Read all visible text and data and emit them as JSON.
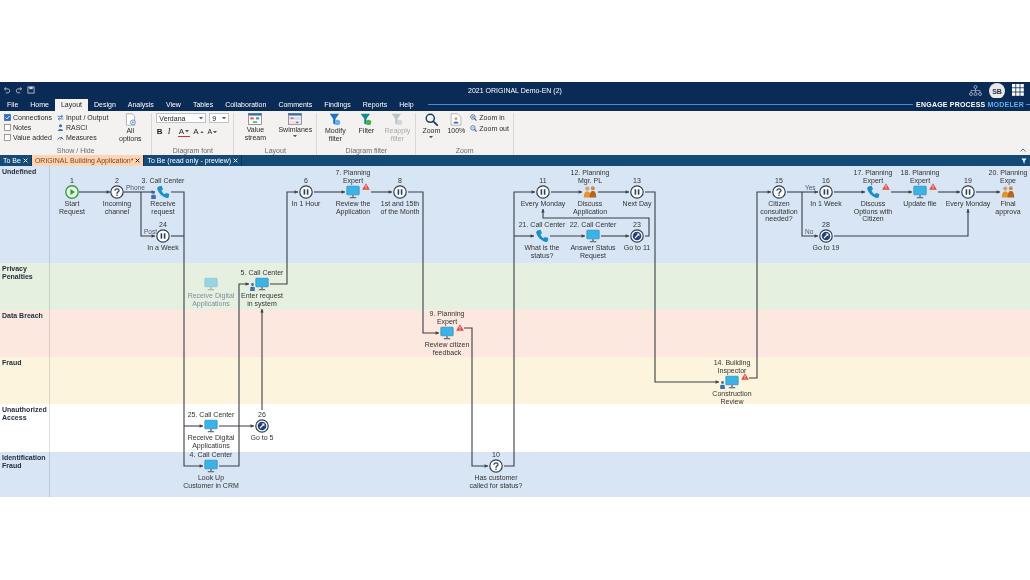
{
  "window": {
    "title": "2021 ORIGINAL Demo-EN (2)",
    "avatar": "SB"
  },
  "menu": [
    {
      "label": "File",
      "selected": false
    },
    {
      "label": "Home",
      "selected": false
    },
    {
      "label": "Layout",
      "selected": true
    },
    {
      "label": "Design",
      "selected": false
    },
    {
      "label": "Analysis",
      "selected": false
    },
    {
      "label": "View",
      "selected": false
    },
    {
      "label": "Tables",
      "selected": false
    },
    {
      "label": "Collaboration",
      "selected": false
    },
    {
      "label": "Comments",
      "selected": false
    },
    {
      "label": "Findings",
      "selected": false
    },
    {
      "label": "Reports",
      "selected": false
    },
    {
      "label": "Help",
      "selected": false
    }
  ],
  "logo": {
    "primary": "ENGAGE PROCESS",
    "secondary": "MODELER"
  },
  "ribbon": {
    "show_hide": {
      "label": "Show / Hide",
      "checkboxes": [
        {
          "label": "Connections",
          "checked": true
        },
        {
          "label": "Notes",
          "checked": false
        },
        {
          "label": "Value added",
          "checked": false
        }
      ],
      "toggles": [
        {
          "label": "Input / Output",
          "kind": "io"
        },
        {
          "label": "RASCI",
          "kind": "rasci"
        },
        {
          "label": "Measures",
          "kind": "measures"
        }
      ],
      "all_options": "All options"
    },
    "font": {
      "label": "Diagram font",
      "family": "Verdana",
      "size": "9",
      "buttons": [
        {
          "text": "B",
          "kind": "bold"
        },
        {
          "text": "I",
          "kind": "italic"
        },
        {
          "text": "A",
          "kind": "color"
        },
        {
          "text": "A",
          "kind": "grow"
        },
        {
          "text": "A",
          "kind": "shrink"
        }
      ]
    },
    "layout": {
      "label": "Layout",
      "buttons": [
        {
          "label": "Value stream",
          "kind": "value_stream",
          "menu": false
        },
        {
          "label": "Swimlanes",
          "kind": "swimlanes",
          "menu": true
        }
      ]
    },
    "filter": {
      "label": "Diagram filter",
      "buttons": [
        {
          "label": "Modify filter",
          "kind": "modify",
          "disabled": false
        },
        {
          "label": "Filter",
          "kind": "filter",
          "disabled": false
        },
        {
          "label": "Reapply filter",
          "kind": "reapply",
          "disabled": true
        }
      ]
    },
    "zoom": {
      "label": "Zoom",
      "buttons": [
        {
          "label": "Zoom",
          "kind": "zoom",
          "menu": true
        },
        {
          "label": "100%",
          "kind": "actual",
          "menu": false
        }
      ],
      "steps": [
        {
          "label": "Zoom in",
          "kind": "in"
        },
        {
          "label": "Zoom out",
          "kind": "out"
        }
      ]
    }
  },
  "document_tabs": [
    {
      "label": "To Be",
      "selected": false
    },
    {
      "label": "ORIGINAL Building Application*",
      "selected": true
    },
    {
      "label": "To Be (read only - preview)",
      "selected": false
    }
  ],
  "lanes": [
    {
      "name": "Undefined",
      "color": "#d7e5f4",
      "nodes": [
        {
          "kind": "start",
          "number": "1",
          "caption": "Start Request",
          "warning": false,
          "person": false,
          "disabled": false
        },
        {
          "kind": "decision",
          "number": "2",
          "caption": "Incoming channel",
          "warning": false,
          "person": false,
          "disabled": false
        },
        {
          "kind": "phone",
          "number": "3. Call Center",
          "caption": "Receive request",
          "warning": false,
          "person": true,
          "disabled": false
        },
        {
          "kind": "wait",
          "number": "6",
          "caption": "In 1 Hour",
          "warning": false,
          "person": false,
          "disabled": false
        },
        {
          "kind": "computer",
          "number": "7. Planning Expert",
          "caption": "Review the Application",
          "warning": true,
          "person": false,
          "disabled": false
        },
        {
          "kind": "wait",
          "number": "8",
          "caption": "1st and 15th of the Month",
          "warning": false,
          "person": false,
          "disabled": false
        },
        {
          "kind": "wait",
          "number": "11",
          "caption": "Every Monday",
          "warning": false,
          "person": false,
          "disabled": false
        },
        {
          "kind": "meeting",
          "number": "12. Planning Mgr. PL",
          "caption": "Discuss Application",
          "warning": false,
          "person": false,
          "disabled": false
        },
        {
          "kind": "wait",
          "number": "13",
          "caption": "Next Day",
          "warning": false,
          "person": false,
          "disabled": false
        },
        {
          "kind": "decision",
          "number": "15",
          "caption": "Citizen consultation needed?",
          "warning": false,
          "person": false,
          "disabled": false
        },
        {
          "kind": "wait",
          "number": "16",
          "caption": "In 1 Week",
          "warning": false,
          "person": false,
          "disabled": false
        },
        {
          "kind": "phone",
          "number": "17. Planning Expert",
          "caption": "Discuss Options with Citizen",
          "warning": true,
          "person": false,
          "disabled": false
        },
        {
          "kind": "computer",
          "number": "18. Planning Expert",
          "caption": "Update file",
          "warning": true,
          "person": false,
          "disabled": false
        },
        {
          "kind": "wait",
          "number": "19",
          "caption": "Every Monday",
          "warning": false,
          "person": false,
          "disabled": false
        },
        {
          "kind": "meeting",
          "number": "20. Planning Expe",
          "caption": "Final approva",
          "warning": false,
          "person": false,
          "disabled": false
        },
        {
          "kind": "wait",
          "number": "24",
          "caption": "In a Week",
          "warning": false,
          "person": false,
          "disabled": false
        },
        {
          "kind": "phone",
          "number": "21. Call Center",
          "caption": "What is the status?",
          "warning": false,
          "person": false,
          "disabled": false
        },
        {
          "kind": "computer",
          "number": "22. Call Center",
          "caption": "Answer Status Request",
          "warning": false,
          "person": false,
          "disabled": false
        },
        {
          "kind": "goto",
          "number": "23",
          "caption": "Go to 11",
          "warning": false,
          "person": false,
          "disabled": false
        },
        {
          "kind": "goto",
          "number": "28",
          "caption": "Go to 19",
          "warning": false,
          "person": false,
          "disabled": false
        }
      ]
    },
    {
      "name": "Privacy Penalties",
      "color": "#e6f0e1",
      "nodes": [
        {
          "kind": "computer",
          "caption": "Receive Digital Applications",
          "warning": false,
          "person": false,
          "disabled": true
        },
        {
          "kind": "computer",
          "number": "5. Call Center",
          "caption": "Enter request in system",
          "warning": false,
          "person": true,
          "disabled": false
        }
      ]
    },
    {
      "name": "Data Breach",
      "color": "#fce8df",
      "nodes": [
        {
          "kind": "computer",
          "number": "9. Planning Expert",
          "caption": "Review citizen feedback",
          "warning": true,
          "person": false,
          "disabled": false
        }
      ]
    },
    {
      "name": "Fraud",
      "color": "#fdf4dd",
      "nodes": [
        {
          "kind": "computer",
          "number": "14. Building Inspector",
          "caption": "Construction Review",
          "warning": true,
          "person": true,
          "disabled": false
        }
      ]
    },
    {
      "name": "Unauthorized Access",
      "color": "#ffffff",
      "nodes": [
        {
          "kind": "computer",
          "number": "25. Call Center",
          "caption": "Receive Digital Applications",
          "warning": false,
          "person": false,
          "disabled": false
        },
        {
          "kind": "goto",
          "number": "26",
          "caption": "Go to 5",
          "warning": false,
          "person": false,
          "disabled": false
        }
      ]
    },
    {
      "name": "Identification Fraud",
      "color": "#d7e5f4",
      "nodes": [
        {
          "kind": "computer",
          "number": "4. Call Center",
          "caption": "Look Up Customer in CRM",
          "warning": false,
          "person": false,
          "disabled": false
        },
        {
          "kind": "decision",
          "number": "10",
          "caption": "Has customer called for status?",
          "warning": false,
          "person": false,
          "disabled": false
        }
      ]
    }
  ],
  "edge_labels": [
    "Phone",
    "Post",
    "Yes",
    "No"
  ]
}
